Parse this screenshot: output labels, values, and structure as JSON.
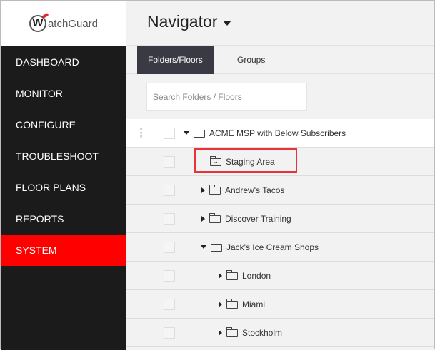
{
  "logo": {
    "text": "WatchGuard"
  },
  "sidebar": {
    "items": [
      {
        "label": "DASHBOARD"
      },
      {
        "label": "MONITOR"
      },
      {
        "label": "CONFIGURE"
      },
      {
        "label": "TROUBLESHOOT"
      },
      {
        "label": "FLOOR PLANS"
      },
      {
        "label": "REPORTS"
      },
      {
        "label": "SYSTEM",
        "active": true
      }
    ]
  },
  "header": {
    "title": "Navigator"
  },
  "tabs": [
    {
      "label": "Folders/Floors"
    },
    {
      "label": "Groups"
    }
  ],
  "search": {
    "placeholder": "Search Folders / Floors"
  },
  "tree": [
    {
      "label": "ACME MSP with Below Subscribers",
      "expanded": true
    },
    {
      "label": "Staging Area",
      "highlighted": true
    },
    {
      "label": "Andrew's Tacos"
    },
    {
      "label": "Discover Training"
    },
    {
      "label": "Jack's Ice Cream Shops",
      "expanded": true
    },
    {
      "label": "London"
    },
    {
      "label": "Miami"
    },
    {
      "label": "Stockholm"
    }
  ],
  "colors": {
    "active": "#ff0000",
    "highlight": "#e8333a"
  }
}
